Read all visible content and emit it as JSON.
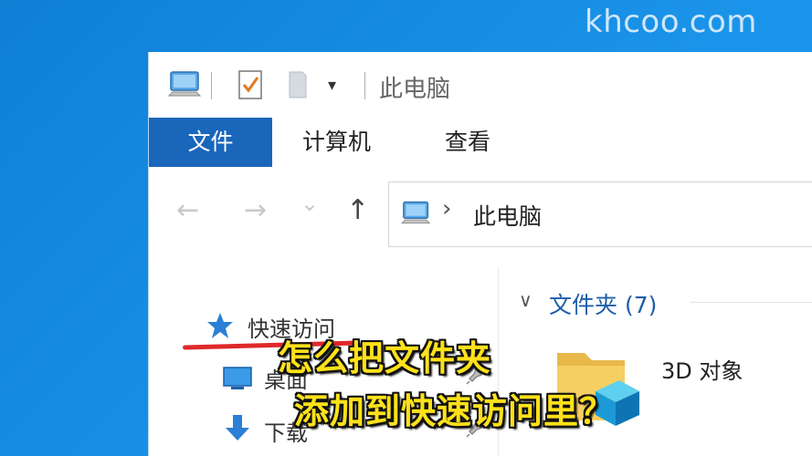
{
  "watermark": "khcoo.com",
  "window": {
    "title": "此电脑",
    "qat_dropdown": "▾"
  },
  "ribbon": {
    "tabs": [
      {
        "label": "文件"
      },
      {
        "label": "计算机"
      },
      {
        "label": "查看"
      }
    ]
  },
  "navbar": {
    "back": "←",
    "forward": "→",
    "recent": "⌄",
    "up": "↑",
    "address_chevron": "›",
    "address": "此电脑"
  },
  "nav_pane": {
    "quick_access": "快速访问",
    "desktop": "桌面",
    "downloads": "下载"
  },
  "content": {
    "folders_header": "文件夹 (7)",
    "folders_chevron": "∨",
    "first_folder": "3D 对象"
  },
  "subtitles": {
    "line1": "怎么把文件夹",
    "line2": "添加到快速访问里？"
  },
  "colors": {
    "desktop": "#1a8ee0",
    "file_tab": "#1a66bb",
    "subtitle": "#ffe11a",
    "annotation": "#e0282a"
  }
}
